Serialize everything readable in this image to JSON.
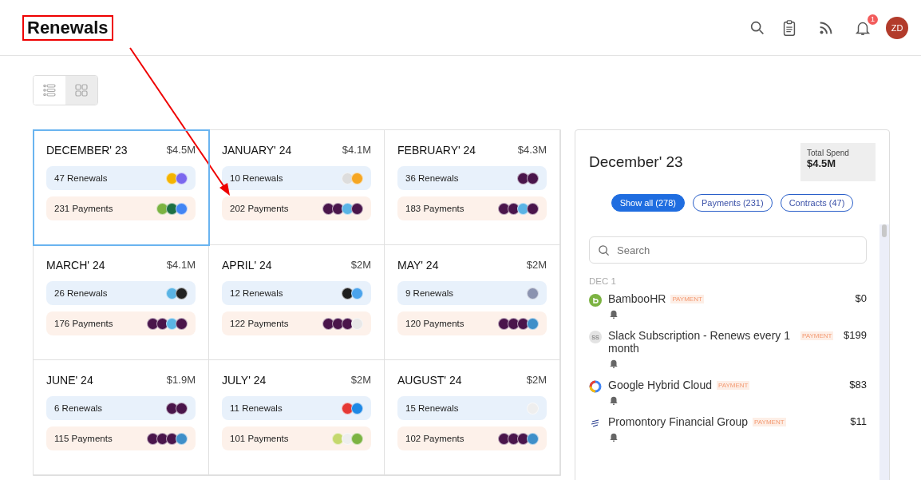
{
  "header": {
    "title": "Renewals",
    "notification_count": "1",
    "avatar_initials": "ZD"
  },
  "view_toggle": [
    {
      "kind": "list",
      "selected": false
    },
    {
      "kind": "grid",
      "selected": true
    }
  ],
  "months": [
    {
      "month": "DECEMBER' 23",
      "amount": "$4.5M",
      "selected": true,
      "renewals": {
        "label": "47 Renewals",
        "logos": [
          {
            "color": "#f4b400"
          },
          {
            "color": "#7b68ee"
          }
        ]
      },
      "payments": {
        "label": "231 Payments",
        "logos": [
          {
            "color": "#7cb342"
          },
          {
            "color": "#1d7044"
          },
          {
            "color": "#4285f4"
          }
        ]
      }
    },
    {
      "month": "JANUARY' 24",
      "amount": "$4.1M",
      "selected": false,
      "renewals": {
        "label": "10 Renewals",
        "logos": [
          {
            "color": "#dddddd"
          },
          {
            "color": "#f5a623"
          }
        ]
      },
      "payments": {
        "label": "202 Payments",
        "logos": [
          {
            "color": "#4a154b"
          },
          {
            "color": "#4a154b"
          },
          {
            "color": "#5ab4e5"
          },
          {
            "color": "#4a154b"
          }
        ]
      }
    },
    {
      "month": "FEBRUARY' 24",
      "amount": "$4.3M",
      "selected": false,
      "renewals": {
        "label": "36 Renewals",
        "logos": [
          {
            "color": "#4a154b"
          },
          {
            "color": "#4a154b"
          }
        ]
      },
      "payments": {
        "label": "183 Payments",
        "logos": [
          {
            "color": "#4a154b"
          },
          {
            "color": "#4a154b"
          },
          {
            "color": "#5ab4e5"
          },
          {
            "color": "#4a154b"
          }
        ]
      }
    },
    {
      "month": "MARCH' 24",
      "amount": "$4.1M",
      "selected": false,
      "renewals": {
        "label": "26 Renewals",
        "logos": [
          {
            "color": "#5ab4e5"
          },
          {
            "color": "#222222"
          }
        ]
      },
      "payments": {
        "label": "176 Payments",
        "logos": [
          {
            "color": "#4a154b"
          },
          {
            "color": "#4a154b"
          },
          {
            "color": "#5ab4e5"
          },
          {
            "color": "#4a154b"
          }
        ]
      }
    },
    {
      "month": "APRIL' 24",
      "amount": "$2M",
      "selected": false,
      "renewals": {
        "label": "12 Renewals",
        "logos": [
          {
            "color": "#1e1e1e"
          },
          {
            "color": "#4aa3ec"
          }
        ]
      },
      "payments": {
        "label": "122 Payments",
        "logos": [
          {
            "color": "#4a154b"
          },
          {
            "color": "#4a154b"
          },
          {
            "color": "#4a154b"
          },
          {
            "color": "#e8e8e8"
          }
        ]
      }
    },
    {
      "month": "MAY' 24",
      "amount": "$2M",
      "selected": false,
      "renewals": {
        "label": "9 Renewals",
        "logos": [
          {
            "color": "#8b93b0"
          }
        ]
      },
      "payments": {
        "label": "120 Payments",
        "logos": [
          {
            "color": "#4a154b"
          },
          {
            "color": "#4a154b"
          },
          {
            "color": "#4a154b"
          },
          {
            "color": "#3e8fc9"
          }
        ]
      }
    },
    {
      "month": "JUNE' 24",
      "amount": "$1.9M",
      "selected": false,
      "renewals": {
        "label": "6 Renewals",
        "logos": [
          {
            "color": "#4a154b"
          },
          {
            "color": "#4a154b"
          }
        ]
      },
      "payments": {
        "label": "115 Payments",
        "logos": [
          {
            "color": "#4a154b"
          },
          {
            "color": "#4a154b"
          },
          {
            "color": "#4a154b"
          },
          {
            "color": "#3e8fc9"
          }
        ]
      }
    },
    {
      "month": "JULY' 24",
      "amount": "$2M",
      "selected": false,
      "renewals": {
        "label": "11 Renewals",
        "logos": [
          {
            "color": "#e53935"
          },
          {
            "color": "#1e88e5"
          }
        ]
      },
      "payments": {
        "label": "101 Payments",
        "logos": [
          {
            "color": "#c5d86d"
          },
          {
            "color": "#eeeeee"
          },
          {
            "color": "#7cb342"
          }
        ]
      }
    },
    {
      "month": "AUGUST' 24",
      "amount": "$2M",
      "selected": false,
      "renewals": {
        "label": "15 Renewals",
        "logos": [
          {
            "color": "#eeeeee"
          }
        ]
      },
      "payments": {
        "label": "102 Payments",
        "logos": [
          {
            "color": "#4a154b"
          },
          {
            "color": "#4a154b"
          },
          {
            "color": "#4a154b"
          },
          {
            "color": "#3e8fc9"
          }
        ]
      }
    }
  ],
  "detail": {
    "title": "December' 23",
    "total_label": "Total Spend",
    "total_value": "$4.5M",
    "filters": [
      {
        "label": "Show all (278)",
        "selected": true
      },
      {
        "label": "Payments (231)",
        "selected": false
      },
      {
        "label": "Contracts (47)",
        "selected": false
      }
    ],
    "search": {
      "placeholder": "Search"
    },
    "date": "DEC 1",
    "items": [
      {
        "name": "BambooHR",
        "tag": "PAYMENT",
        "amount": "$0",
        "kind": "circle",
        "color": "#7cb342"
      },
      {
        "name": "Slack Subscription - Renews every 1 month",
        "tag": "PAYMENT",
        "amount": "$199",
        "kind": "initials",
        "initials": "SS"
      },
      {
        "name": "Google Hybrid Cloud",
        "tag": "PAYMENT",
        "amount": "$83",
        "kind": "ring"
      },
      {
        "name": "Promontory Financial Group",
        "tag": "PAYMENT",
        "amount": "$11",
        "kind": "mark"
      }
    ]
  }
}
